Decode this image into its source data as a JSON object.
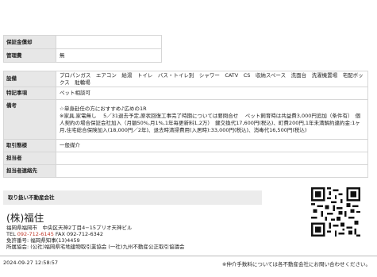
{
  "top_rows": [
    {
      "label": "保証金償却",
      "value": ""
    },
    {
      "label": "管理費",
      "value": "無"
    }
  ],
  "detail_rows": [
    {
      "key": "facilities",
      "label": "設備",
      "value": "プロパンガス　エアコン　給湯　トイレ　バス・トイレ別　シャワー　CATV　CS　収納スペース　洗面台　洗濯機置場　宅配ボックス　駐輪場"
    },
    {
      "key": "special",
      "label": "特記事項",
      "value": "ペット相談可"
    },
    {
      "key": "remarks",
      "label": "備考",
      "value": "☆単身赴任の方におすすめ♪広めの1R\n※家具,家電無し　 5／31退去予定,原状回復工事完了時期については要問合せ　 ペット飼育時は共益費3,000円追加（条件有）　個人契約の場合保証会社加入（月額50%,月1%,1年毎更新料1,2万）　鍵交換代17,600円(税込)、町費200円,1年未満解約違約金:1ヶ月,住宅総合保険加入(18,000円／2年)、退去時清掃費用(入居時):33,000円(税込)、消毒代16,500円(税込)"
    },
    {
      "key": "transaction",
      "label": "取引態様",
      "value": "一般媒介"
    },
    {
      "key": "contact_person",
      "label": "担当者",
      "value": ""
    },
    {
      "key": "contact_info",
      "label": "担当者連絡先",
      "value": ""
    }
  ],
  "agency": {
    "section_title": "取り扱い不動産会社",
    "name": "(株)福住",
    "address": "福岡県福岡市　中央区天神2丁目4−15プリオ天神ビル",
    "tel_label": "TEL",
    "tel": "092-712-6145",
    "fax": "FAX 092-712-6342",
    "license": "免許番号: 福岡県知事(13)4459",
    "association": "所属協会: (公社)福岡県宅地建物取引業協会 (一社)九州不動産公正取引協議会"
  },
  "footer": {
    "timestamp": "2024-09-27 12:58:57",
    "notice": "※仲介手数料については各不動産会社にお問い合わせください。"
  },
  "colors": {
    "label_bg": "#e7e7e7",
    "tel": "#c0392b"
  },
  "icons": [
    "qr-code"
  ]
}
